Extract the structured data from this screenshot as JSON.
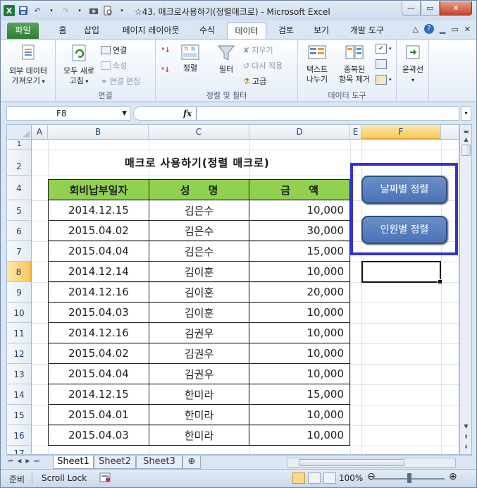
{
  "window": {
    "title": "☆43. 매크로사용하기(정렬매크로) - Microsoft Excel"
  },
  "ribbon": {
    "tabs": [
      {
        "label": "파일"
      },
      {
        "label": "홈"
      },
      {
        "label": "삽입"
      },
      {
        "label": "페이지 레이아웃"
      },
      {
        "label": "수식"
      },
      {
        "label": "데이터"
      },
      {
        "label": "검토"
      },
      {
        "label": "보기"
      },
      {
        "label": "개발 도구"
      }
    ],
    "active_tab": "데이터",
    "external_data": {
      "line1": "외부 데이터",
      "line2": "가져오기"
    },
    "connections": {
      "refresh_all_line1": "모두 새로",
      "refresh_all_line2": "고침",
      "connections": "연결",
      "properties": "속성",
      "edit_links": "연결 편집",
      "group_label": "연결"
    },
    "sort_filter": {
      "sort": "정렬",
      "filter": "필터",
      "clear": "지우기",
      "reapply": "다시 적용",
      "advanced": "고급",
      "group_label": "정렬 및 필터"
    },
    "data_tools": {
      "text_to_columns_line1": "텍스트",
      "text_to_columns_line2": "나누기",
      "remove_duplicates_line1": "중복된",
      "remove_duplicates_line2": "항목 제거",
      "group_label": "데이터 도구"
    },
    "outline": {
      "label": "윤곽선"
    }
  },
  "formula_bar": {
    "name_box": "F8",
    "fx": "fx",
    "formula": ""
  },
  "grid": {
    "columns": [
      "A",
      "B",
      "C",
      "D",
      "E",
      "F"
    ],
    "rows": [
      "1",
      "2",
      "4",
      "5",
      "6",
      "7",
      "8",
      "9",
      "10",
      "11",
      "12",
      "13",
      "14",
      "15",
      "16",
      "17"
    ],
    "selected_cell": "F8"
  },
  "sheet": {
    "title": "매크로 사용하기(정렬 매크로)",
    "table_headers": [
      "회비납부일자",
      "성     명",
      "금     액"
    ],
    "table_rows": [
      [
        "2014.12.15",
        "김은수",
        "10,000"
      ],
      [
        "2015.04.02",
        "김은수",
        "30,000"
      ],
      [
        "2015.04.04",
        "김은수",
        "15,000"
      ],
      [
        "2014.12.14",
        "김이훈",
        "10,000"
      ],
      [
        "2014.12.16",
        "김이훈",
        "20,000"
      ],
      [
        "2015.04.03",
        "김이훈",
        "10,000"
      ],
      [
        "2014.12.16",
        "김권우",
        "10,000"
      ],
      [
        "2015.04.02",
        "김권우",
        "10,000"
      ],
      [
        "2015.04.04",
        "김권우",
        "10,000"
      ],
      [
        "2014.12.15",
        "한미라",
        "15,000"
      ],
      [
        "2015.04.01",
        "한미라",
        "10,000"
      ],
      [
        "2015.04.03",
        "한미라",
        "10,000"
      ]
    ],
    "header_fill": "#92d050",
    "macro_buttons": [
      "날짜별 정렬",
      "인원별 정렬"
    ]
  },
  "sheet_tabs": [
    "Sheet1",
    "Sheet2",
    "Sheet3"
  ],
  "active_sheet": "Sheet1",
  "status": {
    "ready": "준비",
    "scroll_lock": "Scroll Lock",
    "zoom": "100%"
  }
}
